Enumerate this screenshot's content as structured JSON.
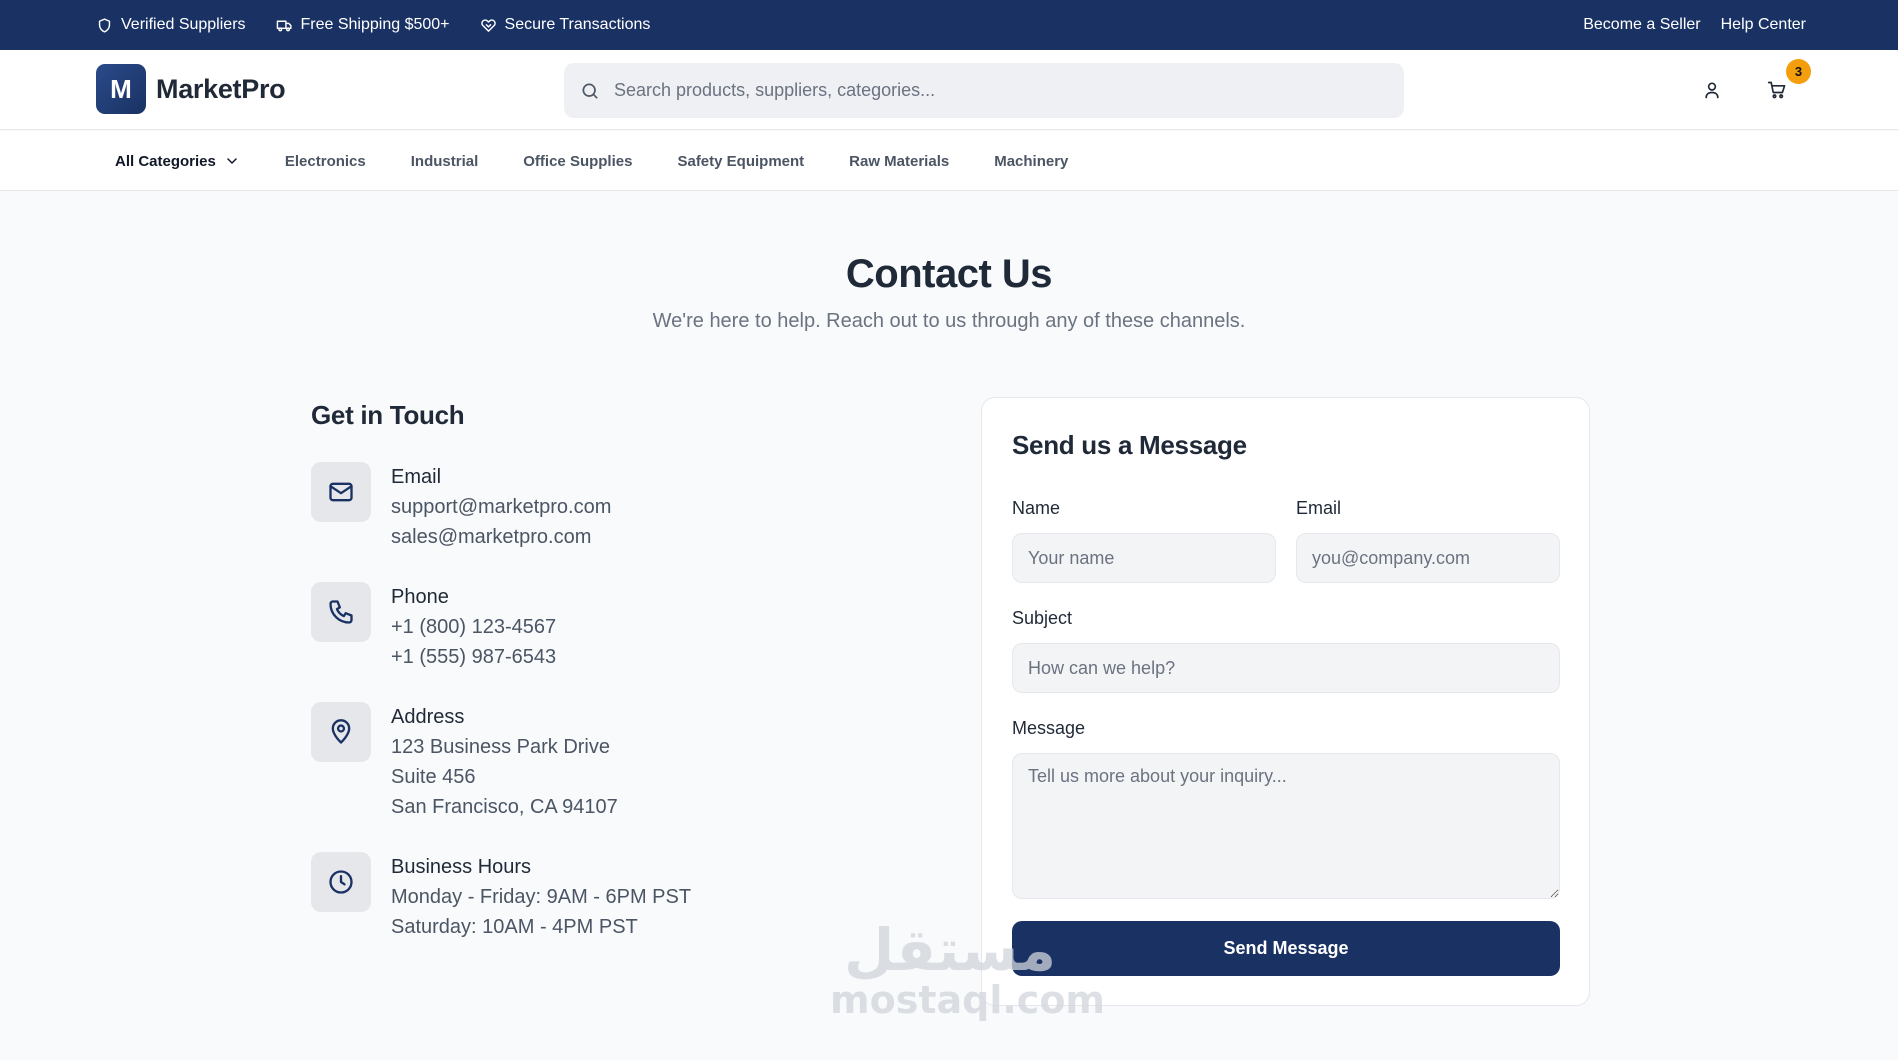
{
  "topbar": {
    "badges": [
      "Verified Suppliers",
      "Free Shipping $500+",
      "Secure Transactions"
    ],
    "links": [
      "Become a Seller",
      "Help Center"
    ]
  },
  "header": {
    "logo_letter": "M",
    "logo_text": "MarketPro",
    "search_placeholder": "Search products, suppliers, categories...",
    "cart_count": "3"
  },
  "categories": {
    "all_label": "All Categories",
    "items": [
      "Electronics",
      "Industrial",
      "Office Supplies",
      "Safety Equipment",
      "Raw Materials",
      "Machinery"
    ]
  },
  "hero": {
    "title": "Contact Us",
    "subtitle": "We're here to help. Reach out to us through any of these channels."
  },
  "get_in_touch": {
    "title": "Get in Touch",
    "email": {
      "title": "Email",
      "lines": [
        "support@marketpro.com",
        "sales@marketpro.com"
      ]
    },
    "phone": {
      "title": "Phone",
      "lines": [
        "+1 (800) 123-4567",
        "+1 (555) 987-6543"
      ]
    },
    "address": {
      "title": "Address",
      "lines": [
        "123 Business Park Drive",
        "Suite 456",
        "San Francisco, CA 94107"
      ]
    },
    "hours": {
      "title": "Business Hours",
      "lines": [
        "Monday - Friday: 9AM - 6PM PST",
        "Saturday: 10AM - 4PM PST"
      ]
    }
  },
  "form": {
    "title": "Send us a Message",
    "name_label": "Name",
    "name_placeholder": "Your name",
    "email_label": "Email",
    "email_placeholder": "you@company.com",
    "subject_label": "Subject",
    "subject_placeholder": "How can we help?",
    "message_label": "Message",
    "message_placeholder": "Tell us more about your inquiry...",
    "submit_label": "Send Message"
  },
  "watermark": {
    "arabic": "مستقل",
    "latin": "mostaql.com"
  },
  "colors": {
    "navy": "#1a3263",
    "badge": "#f59e0b",
    "background": "#f8fafc"
  }
}
